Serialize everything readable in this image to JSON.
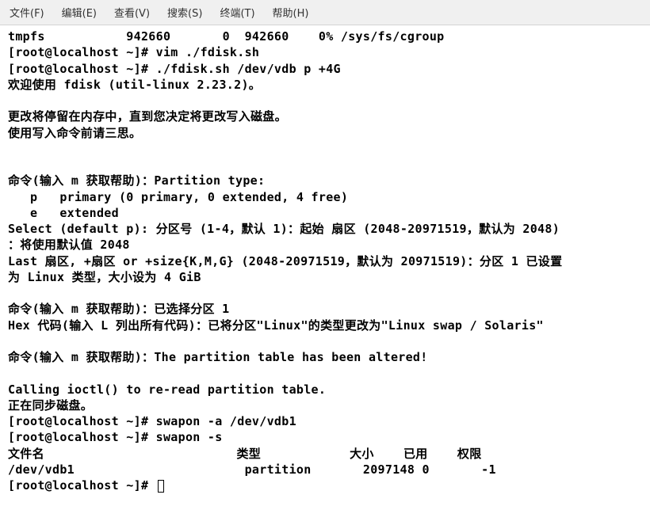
{
  "menubar": {
    "file": "文件(F)",
    "edit": "编辑(E)",
    "view": "查看(V)",
    "search": "搜索(S)",
    "terminal": "终端(T)",
    "help": "帮助(H)"
  },
  "terminal": {
    "lines": [
      "tmpfs           942660       0  942660    0% /sys/fs/cgroup",
      "[root@localhost ~]# vim ./fdisk.sh",
      "[root@localhost ~]# ./fdisk.sh /dev/vdb p +4G",
      "欢迎使用 fdisk (util-linux 2.23.2)。",
      "",
      "更改将停留在内存中，直到您决定将更改写入磁盘。",
      "使用写入命令前请三思。",
      "",
      "",
      "命令(输入 m 获取帮助)：Partition type:",
      "   p   primary (0 primary, 0 extended, 4 free)",
      "   e   extended",
      "Select (default p): 分区号 (1-4，默认 1)：起始 扇区 (2048-20971519，默认为 2048)",
      "：将使用默认值 2048",
      "Last 扇区, +扇区 or +size{K,M,G} (2048-20971519，默认为 20971519)：分区 1 已设置",
      "为 Linux 类型，大小设为 4 GiB",
      "",
      "命令(输入 m 获取帮助)：已选择分区 1",
      "Hex 代码(输入 L 列出所有代码)：已将分区\"Linux\"的类型更改为\"Linux swap / Solaris\"",
      "",
      "命令(输入 m 获取帮助)：The partition table has been altered!",
      "",
      "Calling ioctl() to re-read partition table.",
      "正在同步磁盘。",
      "[root@localhost ~]# swapon -a /dev/vdb1",
      "[root@localhost ~]# swapon -s",
      "文件名                          类型            大小    已用    权限",
      "/dev/vdb1                       partition       2097148 0       -1"
    ],
    "prompt_last": "[root@localhost ~]# "
  }
}
